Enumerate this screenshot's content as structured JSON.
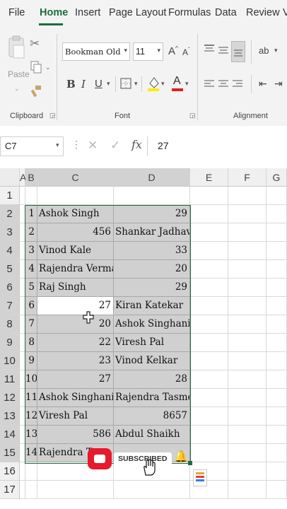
{
  "ribbon_tabs": [
    "File",
    "Home",
    "Insert",
    "Page Layout",
    "Formulas",
    "Data",
    "Review",
    "V"
  ],
  "clipboard": {
    "paste_label": "Paste",
    "group_label": "Clipboard"
  },
  "font": {
    "name": "Bookman Old Style",
    "size": "11",
    "group_label": "Font"
  },
  "alignment": {
    "group_label": "Alignment"
  },
  "formula_bar": {
    "name_box": "C7",
    "formula": "27"
  },
  "columns": [
    "A",
    "B",
    "C",
    "D",
    "E",
    "F",
    "G"
  ],
  "rows": [
    {
      "n": "1",
      "b": "",
      "c": "",
      "d": ""
    },
    {
      "n": "2",
      "b": "1",
      "c": "Ashok Singh",
      "d": "29"
    },
    {
      "n": "3",
      "b": "2",
      "c": "456",
      "d": "Shankar Jadhav"
    },
    {
      "n": "4",
      "b": "3",
      "c": "Vinod Kale",
      "d": "33"
    },
    {
      "n": "5",
      "b": "4",
      "c": "Rajendra Verma",
      "d": "20"
    },
    {
      "n": "6",
      "b": "5",
      "c": "Raj Singh",
      "d": "29"
    },
    {
      "n": "7",
      "b": "6",
      "c": "27",
      "d": "Kiran Katekar"
    },
    {
      "n": "8",
      "b": "7",
      "c": "20",
      "d": "Ashok Singhania"
    },
    {
      "n": "9",
      "b": "8",
      "c": "22",
      "d": "Viresh Pal"
    },
    {
      "n": "10",
      "b": "9",
      "c": "23",
      "d": "Vinod Kelkar"
    },
    {
      "n": "11",
      "b": "10",
      "c": "27",
      "d": "28"
    },
    {
      "n": "12",
      "b": "11",
      "c": "Ashok Singhania",
      "d": "Rajendra Tasme"
    },
    {
      "n": "13",
      "b": "12",
      "c": "Viresh Pal",
      "d": "8657"
    },
    {
      "n": "14",
      "b": "13",
      "c": "586",
      "d": "Abdul Shaikh"
    },
    {
      "n": "15",
      "b": "14",
      "c": "Rajendra Ta",
      "d": ""
    },
    {
      "n": "16",
      "b": "",
      "c": "",
      "d": ""
    },
    {
      "n": "17",
      "b": "",
      "c": "",
      "d": ""
    }
  ],
  "overlay": {
    "subscribe_label": "SUBSCRIBED"
  },
  "colors": {
    "accent": "#1d6b3f",
    "selection": "#d0d0d0",
    "subscribe_red": "#e8192c"
  }
}
